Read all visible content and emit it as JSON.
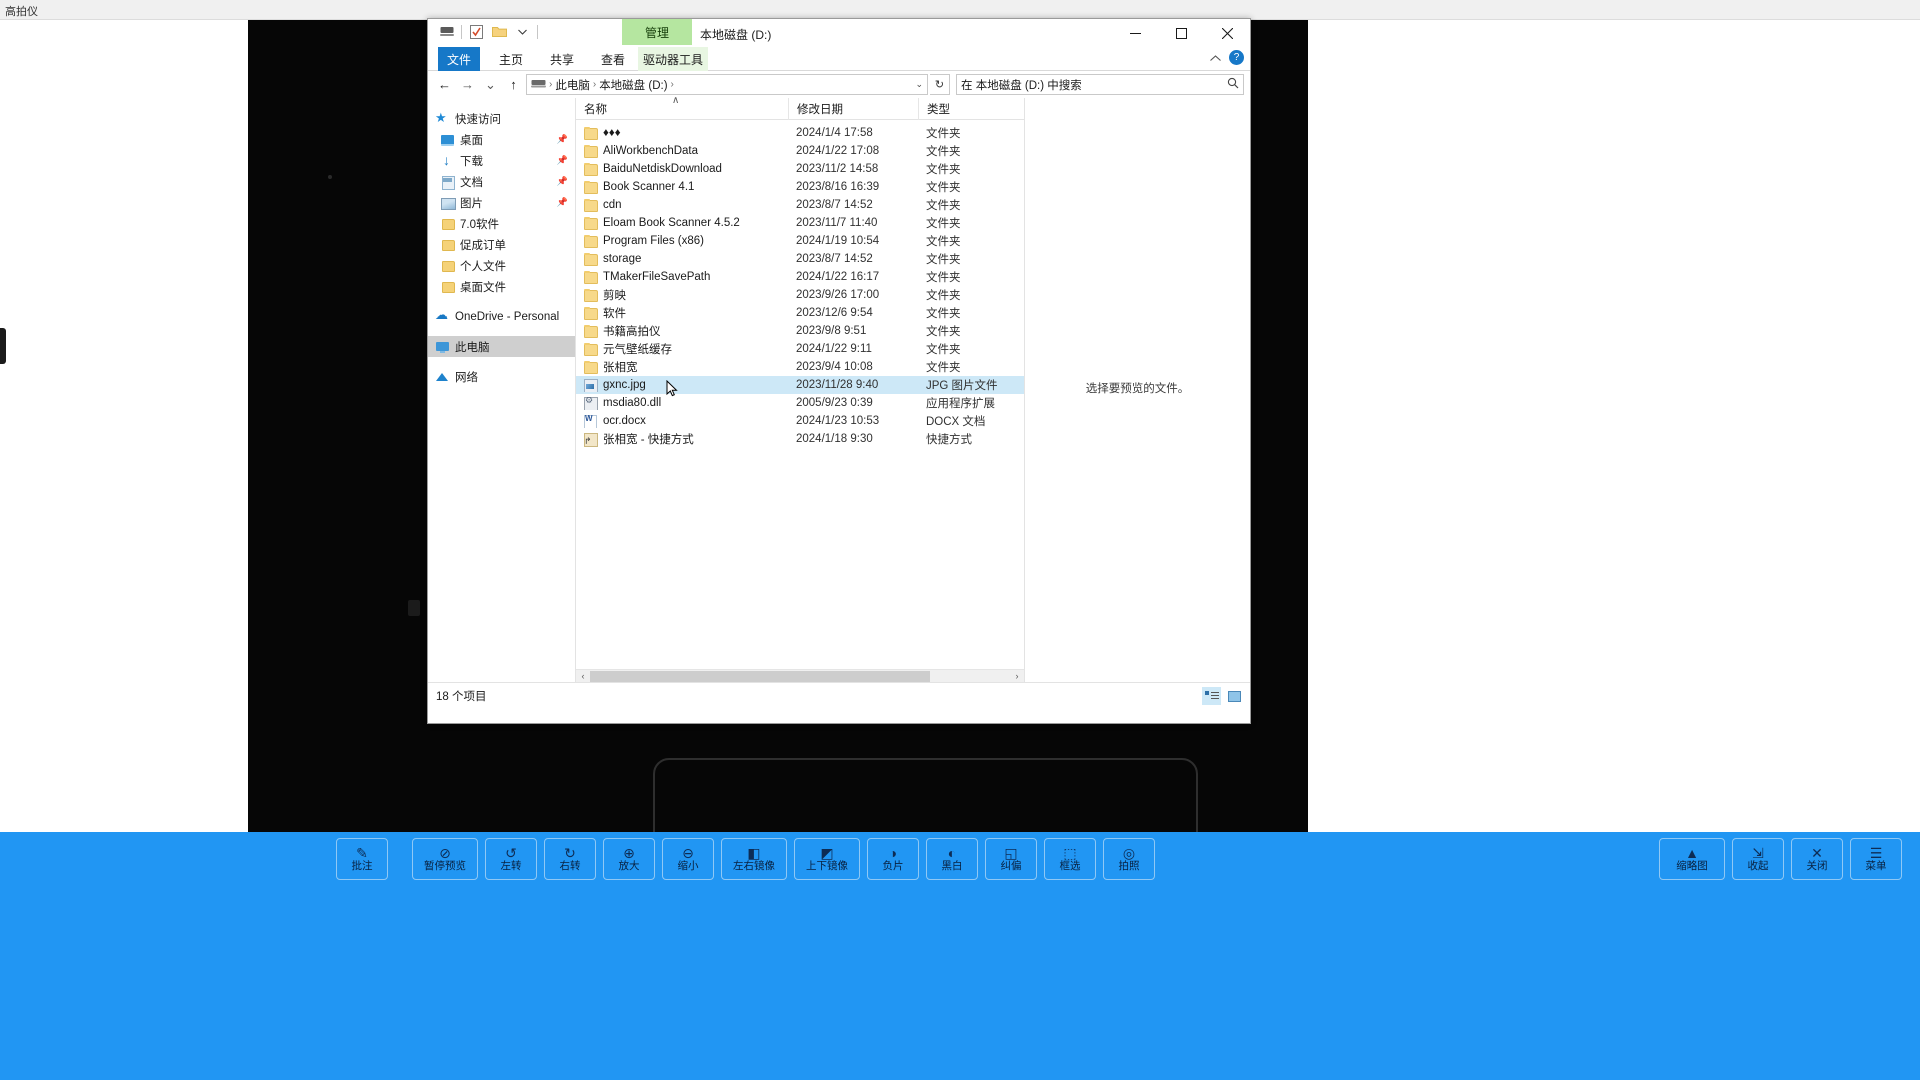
{
  "app": {
    "title": "高拍仪",
    "preview_placeholder": ""
  },
  "explorer": {
    "window_title": "本地磁盘 (D:)",
    "contextual_tab": "管理",
    "quick_access_icons": [
      "this-pc-icon",
      "properties-icon",
      "new-folder-icon",
      "customize-dropdown-icon"
    ],
    "ribbon_tabs": [
      {
        "label": "文件",
        "id": "file"
      },
      {
        "label": "主页",
        "id": "home"
      },
      {
        "label": "共享",
        "id": "share"
      },
      {
        "label": "查看",
        "id": "view"
      },
      {
        "label": "驱动器工具",
        "id": "drive-tools"
      }
    ],
    "ribbon_collapse_icon": "chevron-up-icon",
    "help_label": "?",
    "window_controls": {
      "minimize": "—",
      "maximize": "☐",
      "close": "✕"
    },
    "nav": {
      "back": "←",
      "forward": "→",
      "recent": "⌄",
      "up": "↑"
    },
    "breadcrumb": {
      "root_icon": "drive-icon",
      "items": [
        "此电脑",
        "本地磁盘 (D:)"
      ],
      "separator": "›",
      "dropdown": "⌄"
    },
    "refresh_icon": "↻",
    "search": {
      "value": "在 本地磁盘 (D:) 中搜索",
      "icon": "search-icon"
    },
    "nav_pane": [
      {
        "label": "快速访问",
        "icon": "star",
        "pinned": false,
        "root": true
      },
      {
        "label": "桌面",
        "icon": "desk",
        "pinned": true
      },
      {
        "label": "下载",
        "icon": "dl",
        "pinned": true
      },
      {
        "label": "文档",
        "icon": "doc",
        "pinned": true
      },
      {
        "label": "图片",
        "icon": "pic",
        "pinned": true
      },
      {
        "label": "7.0软件",
        "icon": "fold",
        "pinned": false
      },
      {
        "label": "促成订单",
        "icon": "fold",
        "pinned": false
      },
      {
        "label": "个人文件",
        "icon": "fold",
        "pinned": false
      },
      {
        "label": "桌面文件",
        "icon": "fold",
        "pinned": false
      },
      {
        "label": "OneDrive - Personal",
        "icon": "cloud",
        "pinned": false,
        "root": true,
        "gap": true
      },
      {
        "label": "此电脑",
        "icon": "pc",
        "pinned": false,
        "root": true,
        "gap": true,
        "selected": true
      },
      {
        "label": "网络",
        "icon": "net",
        "pinned": false,
        "root": true,
        "gap": true
      }
    ],
    "columns": {
      "name": "名称",
      "date": "修改日期",
      "type": "类型",
      "sort_arrow": "∧"
    },
    "files": [
      {
        "name": "♦♦♦",
        "date": "2024/1/4 17:58",
        "type": "文件夹",
        "icon": "folder"
      },
      {
        "name": "AliWorkbenchData",
        "date": "2024/1/22 17:08",
        "type": "文件夹",
        "icon": "folder"
      },
      {
        "name": "BaiduNetdiskDownload",
        "date": "2023/11/2 14:58",
        "type": "文件夹",
        "icon": "folder"
      },
      {
        "name": "Book Scanner 4.1",
        "date": "2023/8/16 16:39",
        "type": "文件夹",
        "icon": "folder"
      },
      {
        "name": "cdn",
        "date": "2023/8/7 14:52",
        "type": "文件夹",
        "icon": "folder"
      },
      {
        "name": "Eloam Book Scanner 4.5.2",
        "date": "2023/11/7 11:40",
        "type": "文件夹",
        "icon": "folder"
      },
      {
        "name": "Program Files (x86)",
        "date": "2024/1/19 10:54",
        "type": "文件夹",
        "icon": "folder"
      },
      {
        "name": "storage",
        "date": "2023/8/7 14:52",
        "type": "文件夹",
        "icon": "folder"
      },
      {
        "name": "TMakerFileSavePath",
        "date": "2024/1/22 16:17",
        "type": "文件夹",
        "icon": "folder"
      },
      {
        "name": "剪映",
        "date": "2023/9/26 17:00",
        "type": "文件夹",
        "icon": "folder"
      },
      {
        "name": "软件",
        "date": "2023/12/6 9:54",
        "type": "文件夹",
        "icon": "folder"
      },
      {
        "name": "书籍高拍仪",
        "date": "2023/9/8 9:51",
        "type": "文件夹",
        "icon": "folder"
      },
      {
        "name": "元气壁纸缓存",
        "date": "2024/1/22 9:11",
        "type": "文件夹",
        "icon": "folder"
      },
      {
        "name": "张相宽",
        "date": "2023/9/4 10:08",
        "type": "文件夹",
        "icon": "folder"
      },
      {
        "name": "gxnc.jpg",
        "date": "2023/11/28 9:40",
        "type": "JPG 图片文件",
        "icon": "jpg",
        "selected": true
      },
      {
        "name": "msdia80.dll",
        "date": "2005/9/23 0:39",
        "type": "应用程序扩展",
        "icon": "dll"
      },
      {
        "name": "ocr.docx",
        "date": "2024/1/23 10:53",
        "type": "DOCX 文档",
        "icon": "docx"
      },
      {
        "name": "张相宽 - 快捷方式",
        "date": "2024/1/18 9:30",
        "type": "快捷方式",
        "icon": "lnk"
      }
    ],
    "preview_message": "选择要预览的文件。",
    "status_text": "18 个项目",
    "view_buttons": [
      {
        "icon": "details-view-icon",
        "active": true
      },
      {
        "icon": "large-icons-view-icon",
        "active": false
      }
    ],
    "hscroll": {
      "left_arrow": "‹",
      "right_arrow": "›"
    }
  },
  "bottom_toolbar": {
    "groups": [
      [
        {
          "label": "批注",
          "glyph": "✎",
          "icon": "annotate-icon"
        }
      ],
      [
        {
          "label": "暂停预览",
          "glyph": "⊘",
          "icon": "pause-preview-icon",
          "wide": true
        },
        {
          "label": "左转",
          "glyph": "↺",
          "icon": "rotate-left-icon"
        },
        {
          "label": "右转",
          "glyph": "↻",
          "icon": "rotate-right-icon"
        },
        {
          "label": "放大",
          "glyph": "⊕",
          "icon": "zoom-in-icon"
        },
        {
          "label": "缩小",
          "glyph": "⊖",
          "icon": "zoom-out-icon"
        },
        {
          "label": "左右镜像",
          "glyph": "◧",
          "icon": "mirror-horizontal-icon",
          "wide": true
        },
        {
          "label": "上下镜像",
          "glyph": "◩",
          "icon": "mirror-vertical-icon",
          "wide": true
        },
        {
          "label": "负片",
          "glyph": "◑",
          "icon": "negative-icon"
        },
        {
          "label": "黑白",
          "glyph": "◐",
          "icon": "black-white-icon"
        },
        {
          "label": "纠偏",
          "glyph": "◱",
          "icon": "deskew-icon"
        },
        {
          "label": "框选",
          "glyph": "⬚",
          "icon": "crop-select-icon"
        },
        {
          "label": "拍照",
          "glyph": "◎",
          "icon": "capture-icon"
        }
      ]
    ],
    "right_buttons": [
      {
        "label": "缩略图",
        "glyph": "▲",
        "icon": "thumbnail-icon",
        "wide": true
      },
      {
        "label": "收起",
        "glyph": "⇲",
        "icon": "collapse-icon"
      },
      {
        "label": "关闭",
        "glyph": "✕",
        "icon": "close-app-icon"
      },
      {
        "label": "菜单",
        "glyph": "☰",
        "icon": "menu-icon"
      }
    ]
  }
}
